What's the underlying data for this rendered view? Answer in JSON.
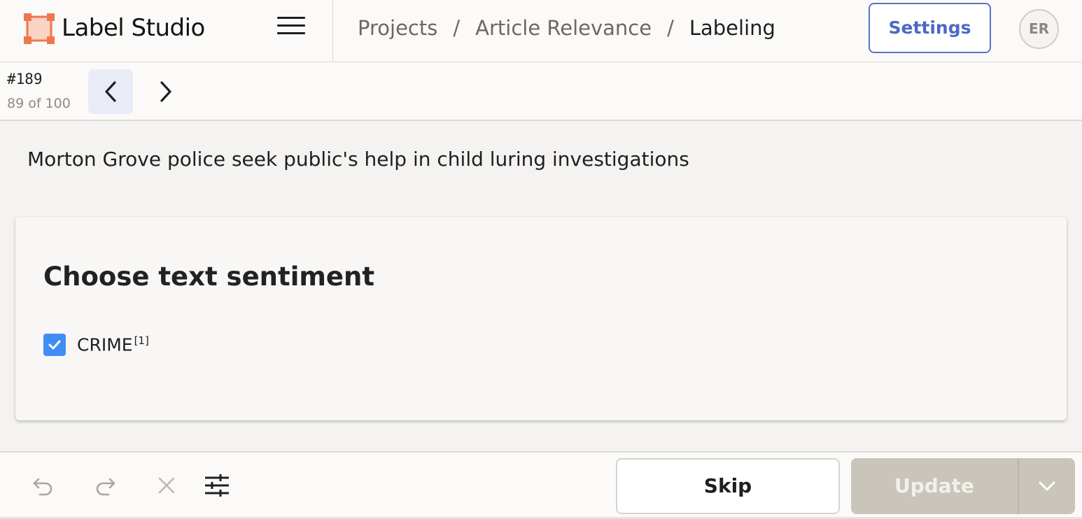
{
  "app": {
    "brand": "Label Studio",
    "brand_color": "#f0764f"
  },
  "header": {
    "breadcrumbs": [
      {
        "label": "Projects"
      },
      {
        "label": "Article Relevance"
      },
      {
        "label": "Labeling"
      }
    ],
    "separator": "/",
    "settings_label": "Settings",
    "avatar_initials": "ER"
  },
  "task": {
    "id": "#189",
    "position": "89 of 100"
  },
  "content": {
    "text": "Morton Grove police seek public's help in child luring investigations",
    "question": "Choose text sentiment",
    "choices": [
      {
        "label": "CRIME",
        "hotkey": "[1]",
        "checked": true
      }
    ]
  },
  "footer": {
    "skip_label": "Skip",
    "update_label": "Update"
  },
  "colors": {
    "accent": "#4d68c4",
    "checkbox": "#3f8ef6",
    "update_disabled": "#c9c5bb"
  }
}
